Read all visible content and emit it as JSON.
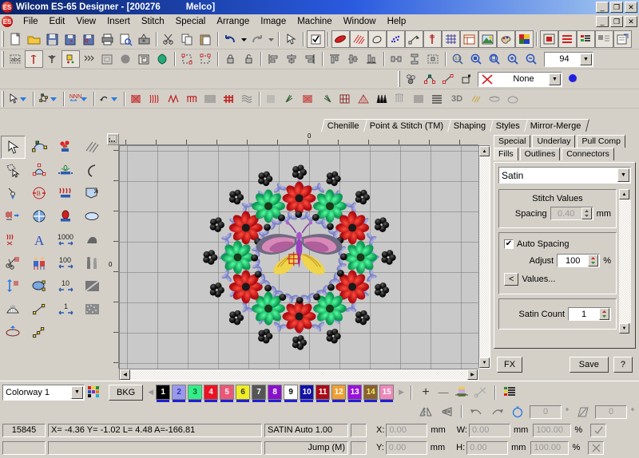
{
  "window": {
    "title": "Wilcom ES-65 Designer - [200276          Melco]",
    "minimize": "_",
    "maximize": "❐",
    "close": "✕",
    "logo_text": "ES"
  },
  "menu": {
    "items": [
      "File",
      "Edit",
      "View",
      "Insert",
      "Stitch",
      "Special",
      "Arrange",
      "Image",
      "Machine",
      "Window",
      "Help"
    ],
    "child_minimize": "_",
    "child_maximize": "❐",
    "child_close": "✕"
  },
  "toolbar_standard": {
    "icons": [
      "new-document-icon",
      "open-folder-icon",
      "save-disk-icon",
      "save-all-icon",
      "save-as-icon",
      "print-icon",
      "print-preview-icon",
      "send-to-machine-icon",
      "cut-scissors-icon",
      "copy-icon",
      "paste-icon",
      "undo-icon",
      "undo-dropdown-icon",
      "redo-icon",
      "redo-dropdown-icon",
      "select-object-icon",
      "select-check-icon",
      "satin-stitch-icon",
      "fill-stitch-icon",
      "outline-icon",
      "scatter-icon",
      "node-edit-icon",
      "needle-icon",
      "grid-icon",
      "hoop-icon",
      "backdrop-image-icon",
      "color-palette-icon",
      "picture-icon",
      "thumbnail-icon",
      "color-film-icon",
      "color-bars-icon",
      "stitch-list-icon",
      "object-properties-icon"
    ]
  },
  "toolbar_second": {
    "icons": [
      "lettering-icon",
      "needle-point-icon",
      "anchor-icon",
      "auto-digitize-icon",
      "run-stitch-icon",
      "applique-icon",
      "ellipse-fill-icon",
      "maze-fill-icon",
      "motif-icon",
      "group-icon",
      "ungroup-icon",
      "lock-icon",
      "unlock-icon",
      "align-left-icon",
      "align-center-icon",
      "align-right-icon",
      "align-top-icon",
      "align-middle-icon",
      "align-bottom-icon",
      "distribute-h-icon",
      "distribute-v-icon",
      "space-even-icon",
      "reshape-icon",
      "zoom-100-icon",
      "zoom-box-icon",
      "zoom-fit-icon",
      "zoom-in-icon",
      "zoom-out-icon"
    ],
    "zoom_value": "94"
  },
  "toolbar_third": {
    "icons": [
      "connect-objects-icon",
      "node-points-icon",
      "travel-start-icon",
      "travel-end-icon",
      "no-fill-icon",
      "color-wheel-icon"
    ],
    "fill_value": "None"
  },
  "toolbar_stitch": {
    "icons": [
      "pointer-dropdown-icon",
      "polygon-dropdown-icon",
      "stitch-type-dropdown-icon",
      "lettering-dropdown-icon",
      "satin-icon",
      "zigzag-icon",
      "e-stitch-icon",
      "blanket-icon",
      "tatami-icon",
      "cross-stitch-icon",
      "wave-icon",
      "column-fill-icon",
      "leaf-fill-icon",
      "spiral-icon",
      "fancy-fill-icon",
      "lattice-icon",
      "triangle-fill-icon",
      "zigzag-column-icon",
      "candlewick-icon",
      "step-fill-icon",
      "horizontal-lines-icon",
      "3d-icon",
      "texture-icon",
      "lens-icon",
      "hoop-view-icon"
    ],
    "label_3d": "3D"
  },
  "doc_tabs": [
    {
      "label": "Chenille",
      "active": false
    },
    {
      "label": "Point & Stitch (TM)",
      "active": false
    },
    {
      "label": "Shaping",
      "active": false
    },
    {
      "label": "Styles",
      "active": false
    },
    {
      "label": "Mirror-Merge",
      "active": false
    }
  ],
  "toolbox": {
    "tools": [
      "select-object-tool",
      "reshape-node-tool",
      "flower-motif-tool",
      "slant-lines-tool",
      "polygon-select-tool",
      "arch-envelope-tool",
      "motif-fill-tool",
      "arc-tool",
      "pendant-tool",
      "rotate-mirror-tool",
      "zigzag-motif-tool",
      "offset-fill-tool",
      "stitch-effect-tool",
      "mirror-merge-tool",
      "applique-shape-tool",
      "ellipse-tool",
      "wreath-tool",
      "monogram-tool",
      "anchor-stitch-tool",
      "rectangle-tool",
      "auto-branch-tool",
      "lettering-tool",
      "count-1000-tool",
      "texture-dark-tool",
      "scissors-trim-tool",
      "twins-mirror-tool",
      "count-100-tool",
      "silhouette-tool",
      "stitch-direction-tool",
      "curve-envelope-tool",
      "count-10-tool",
      "gradient-fill-tool",
      "fan-shape-tool",
      "open-line-tool",
      "count-1-tool",
      "noise-fill-tool",
      "ellipse-shape-tool",
      "closed-line-tool",
      "",
      ""
    ]
  },
  "canvas": {
    "ruler_origin_label": "0",
    "ruler_left_label": "0",
    "background_color": "#c9c9c9",
    "design_name": "floral-mandala-with-butterfly-embroidery"
  },
  "properties": {
    "tabs_top": [
      {
        "label": "Special",
        "active": false
      },
      {
        "label": "Underlay",
        "active": false
      },
      {
        "label": "Pull Comp",
        "active": false
      }
    ],
    "tabs_bottom": [
      {
        "label": "Fills",
        "active": true
      },
      {
        "label": "Outlines",
        "active": false
      },
      {
        "label": "Connectors",
        "active": false
      }
    ],
    "stitch_type": "Satin",
    "section_title": "Stitch Values",
    "spacing_label": "Spacing",
    "spacing_value": "0.40",
    "spacing_unit": "mm",
    "auto_spacing_label": "Auto Spacing",
    "auto_spacing_checked": true,
    "adjust_label": "Adjust",
    "adjust_value": "100",
    "adjust_unit": "%",
    "values_button": "Values...",
    "values_arrow": "<",
    "satin_count_label": "Satin Count",
    "satin_count_value": "1",
    "fx_button": "FX",
    "save_button": "Save",
    "help_button": "?"
  },
  "colorbar": {
    "colorway": "Colorway 1",
    "palette_icon": "palette-grid-icon",
    "bkg_button": "BKG",
    "prev_arrow": "◀",
    "next_arrow": "▶",
    "add_label": "+",
    "remove_label": "—",
    "thread_icon": "thread-cone-icon",
    "cut_icon": "cut-thread-icon",
    "list_icon": "color-list-icon",
    "swatches": [
      {
        "num": "1",
        "bg": "#000000",
        "fg": "#ffffff",
        "bar": "#2020cc"
      },
      {
        "num": "2",
        "bg": "#9999ee",
        "fg": "#3333aa",
        "bar": "#2020cc"
      },
      {
        "num": "3",
        "bg": "#33ee88",
        "fg": "#0a6b33",
        "bar": "#2020cc"
      },
      {
        "num": "4",
        "bg": "#ee1122",
        "fg": "#ffffff",
        "bar": "#2020cc"
      },
      {
        "num": "5",
        "bg": "#ee5577",
        "fg": "#ffffff",
        "bar": "#2020cc"
      },
      {
        "num": "6",
        "bg": "#eeee22",
        "fg": "#333333",
        "bar": "#2020cc"
      },
      {
        "num": "7",
        "bg": "#555555",
        "fg": "#ffffff",
        "bar": "#2020cc"
      },
      {
        "num": "8",
        "bg": "#8811cc",
        "fg": "#ffffff",
        "bar": "#2020cc"
      },
      {
        "num": "9",
        "bg": "#ffffff",
        "fg": "#000000",
        "bar": "#2020cc"
      },
      {
        "num": "10",
        "bg": "#1111aa",
        "fg": "#ffffff",
        "bar": "#2020cc"
      },
      {
        "num": "11",
        "bg": "#aa0b18",
        "fg": "#ffffff",
        "bar": "#2020cc"
      },
      {
        "num": "12",
        "bg": "#f0a030",
        "fg": "#ffffff",
        "bar": "#2020cc"
      },
      {
        "num": "13",
        "bg": "#9911dd",
        "fg": "#ffffff",
        "bar": "#2020cc"
      },
      {
        "num": "14",
        "bg": "#8a6030",
        "fg": "#eeee66",
        "bar": "#2020cc"
      },
      {
        "num": "15",
        "bg": "#ee88bb",
        "fg": "#ffffff",
        "bar": "#2020cc"
      }
    ]
  },
  "transform_bar": {
    "mirror_h_icon": "mirror-horizontal-icon",
    "mirror_v_icon": "mirror-vertical-icon",
    "rotate_ccw_icon": "rotate-counterclockwise-icon",
    "rotate_cw_icon": "rotate-clockwise-icon",
    "rotate_angle_icon": "rotate-angle-icon",
    "rotate_value": "0",
    "rotate_unit": "°",
    "skew_icon": "skew-icon",
    "skew_value": "0",
    "skew_unit": "°"
  },
  "statusbar": {
    "stitch_count": "15845",
    "coords": "X=  -4.36 Y=  -1.02 L=   4.48 A=-166.81",
    "stitch_info": "SATIN Auto  1.00",
    "jump_info": "Jump (M)",
    "x_label": "X:",
    "x_value": "0.00",
    "x_unit": "mm",
    "y_label": "Y:",
    "y_value": "0.00",
    "y_unit": "mm",
    "w_label": "W:",
    "w_value": "0.00",
    "w_unit": "mm",
    "w_pct": "100.00",
    "pct": "%",
    "h_label": "H:",
    "h_value": "0.00",
    "h_unit": "mm",
    "h_pct": "100.00",
    "apply_icon": "checkmark-icon",
    "cancel_icon": "cross-icon"
  }
}
